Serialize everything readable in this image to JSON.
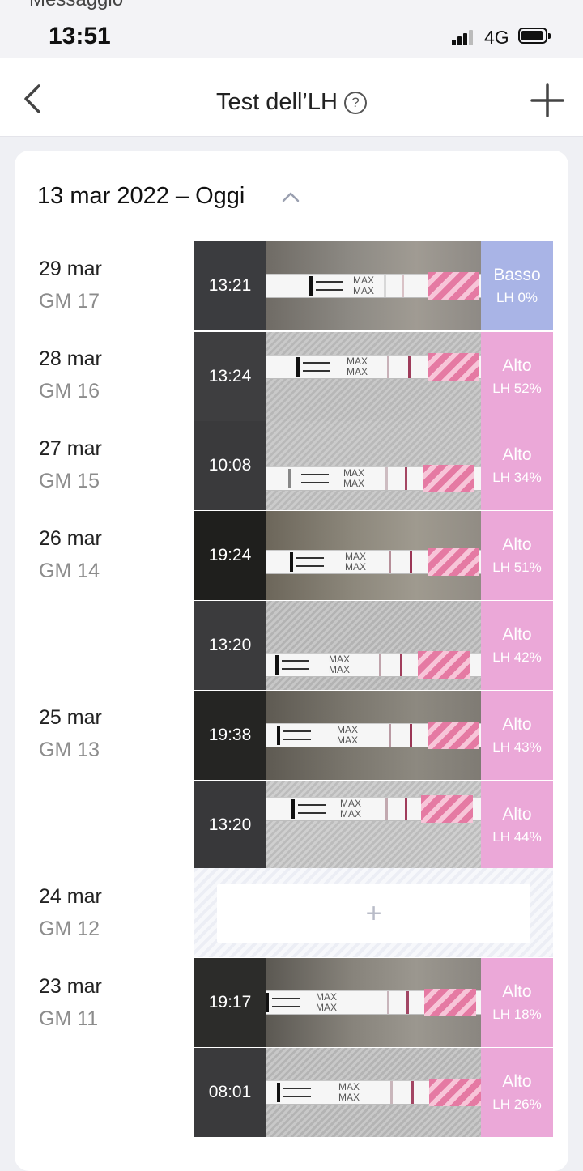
{
  "status": {
    "prev_app": "Messaggio",
    "time": "13:51",
    "network": "4G"
  },
  "nav": {
    "title": "Test dell’LH",
    "help": "?"
  },
  "section": {
    "title": "13 mar 2022 – Oggi"
  },
  "days": [
    {
      "date": "29 mar",
      "cycle_day": "GM 17"
    },
    {
      "date": "28 mar",
      "cycle_day": "GM 16"
    },
    {
      "date": "27 mar",
      "cycle_day": "GM 15"
    },
    {
      "date": "26 mar",
      "cycle_day": "GM 14"
    },
    {
      "date": "25 mar",
      "cycle_day": "GM 13"
    },
    {
      "date": "24 mar",
      "cycle_day": "GM 12"
    },
    {
      "date": "23 mar",
      "cycle_day": "GM 11"
    }
  ],
  "tests": [
    {
      "time": "13:21",
      "level": "Basso",
      "lh": "LH 0%",
      "tone": "low",
      "lh_percent": 0
    },
    {
      "time": "13:24",
      "level": "Alto",
      "lh": "LH 52%",
      "tone": "high",
      "lh_percent": 52
    },
    {
      "time": "10:08",
      "level": "Alto",
      "lh": "LH 34%",
      "tone": "high",
      "lh_percent": 34
    },
    {
      "time": "19:24",
      "level": "Alto",
      "lh": "LH 51%",
      "tone": "high",
      "lh_percent": 51
    },
    {
      "time": "13:20",
      "level": "Alto",
      "lh": "LH 42%",
      "tone": "high",
      "lh_percent": 42
    },
    {
      "time": "19:38",
      "level": "Alto",
      "lh": "LH 43%",
      "tone": "high",
      "lh_percent": 43
    },
    {
      "time": "13:20",
      "level": "Alto",
      "lh": "LH 44%",
      "tone": "high",
      "lh_percent": 44
    },
    {
      "time": "19:17",
      "level": "Alto",
      "lh": "LH 18%",
      "tone": "high",
      "lh_percent": 18
    },
    {
      "time": "08:01",
      "level": "Alto",
      "lh": "LH 26%",
      "tone": "high",
      "lh_percent": 26
    }
  ],
  "strip_label": "MAX",
  "add_symbol": "+",
  "colors": {
    "low": "#a9b4e6",
    "high": "#eba8d8",
    "accent": "#e57aa3"
  }
}
